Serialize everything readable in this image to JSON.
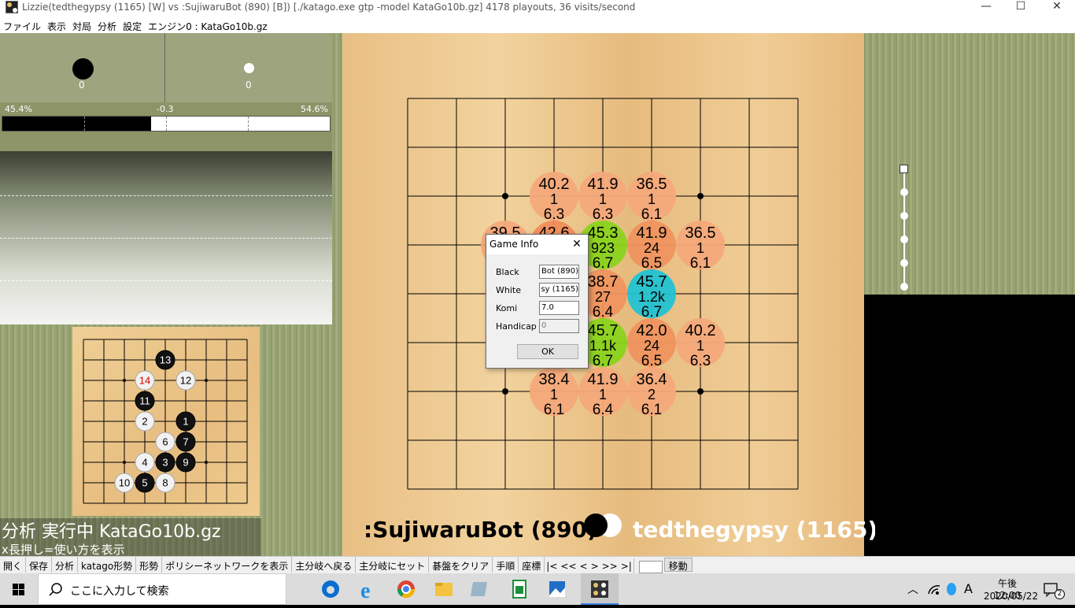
{
  "window": {
    "title": "Lizzie(tedthegypsy (1165) [W] vs :SujiwaruBot (890) [B]) [./katago.exe gtp -model KataGo10b.gz] 4178 playouts, 36 visits/second",
    "minimize": "—",
    "maximize": "☐",
    "close": "✕"
  },
  "menu": [
    "ファイル",
    "表示",
    "対局",
    "分析",
    "設定",
    "エンジン0 : KataGo10b.gz"
  ],
  "score": {
    "black_captures": "0",
    "white_captures": "0",
    "black_winrate": "45.4%",
    "score_lead": "-0.3",
    "white_winrate": "54.6%",
    "black_winrate_value": 45.4
  },
  "status": {
    "line1": "分析 実行中 KataGo10b.gz",
    "line2": "x長押し=使い方を表示"
  },
  "players": {
    "black": ":SujiwaruBot (890)",
    "white": "tedthegypsy (1165)"
  },
  "mini_board_stones": [
    {
      "n": "13",
      "c": "b",
      "col": 4,
      "row": 1
    },
    {
      "n": "14",
      "c": "w",
      "col": 3,
      "row": 2,
      "red": true
    },
    {
      "n": "12",
      "c": "w",
      "col": 5,
      "row": 2
    },
    {
      "n": "11",
      "c": "b",
      "col": 3,
      "row": 3
    },
    {
      "n": "2",
      "c": "w",
      "col": 3,
      "row": 4
    },
    {
      "n": "1",
      "c": "b",
      "col": 5,
      "row": 4
    },
    {
      "n": "6",
      "c": "w",
      "col": 4,
      "row": 5
    },
    {
      "n": "7",
      "c": "b",
      "col": 5,
      "row": 5
    },
    {
      "n": "4",
      "c": "w",
      "col": 3,
      "row": 6
    },
    {
      "n": "3",
      "c": "b",
      "col": 4,
      "row": 6
    },
    {
      "n": "9",
      "c": "b",
      "col": 5,
      "row": 6
    },
    {
      "n": "10",
      "c": "w",
      "col": 2,
      "row": 7
    },
    {
      "n": "5",
      "c": "b",
      "col": 3,
      "row": 7
    },
    {
      "n": "8",
      "c": "w",
      "col": 4,
      "row": 7
    }
  ],
  "candidates": [
    {
      "col": 3,
      "row": 2,
      "wr": "40.2",
      "v": "1",
      "s": "6.3",
      "color": "#f4a97a"
    },
    {
      "col": 4,
      "row": 2,
      "wr": "41.9",
      "v": "1",
      "s": "6.3",
      "color": "#f4a97a"
    },
    {
      "col": 5,
      "row": 2,
      "wr": "36.5",
      "v": "1",
      "s": "6.1",
      "color": "#f4a97a"
    },
    {
      "col": 2,
      "row": 3,
      "wr": "39.5",
      "v": "",
      "s": "",
      "color": "#f4a97a"
    },
    {
      "col": 3,
      "row": 3,
      "wr": "42.6",
      "v": "",
      "s": "",
      "color": "#f08c5a"
    },
    {
      "col": 4,
      "row": 3,
      "wr": "45.3",
      "v": "923",
      "s": "6.7",
      "color": "#8ad31c"
    },
    {
      "col": 5,
      "row": 3,
      "wr": "41.9",
      "v": "24",
      "s": "6.5",
      "color": "#ef935f"
    },
    {
      "col": 6,
      "row": 3,
      "wr": "36.5",
      "v": "1",
      "s": "6.1",
      "color": "#f4a97a"
    },
    {
      "col": 4,
      "row": 4,
      "wr": "38.7",
      "v": "27",
      "s": "6.4",
      "color": "#ef935f"
    },
    {
      "col": 5,
      "row": 4,
      "wr": "45.7",
      "v": "1.2k",
      "s": "6.7",
      "color": "#22c3d3"
    },
    {
      "col": 4,
      "row": 5,
      "wr": "45.7",
      "v": "1.1k",
      "s": "6.7",
      "color": "#8ad31c"
    },
    {
      "col": 5,
      "row": 5,
      "wr": "42.0",
      "v": "24",
      "s": "6.5",
      "color": "#ef935f"
    },
    {
      "col": 6,
      "row": 5,
      "wr": "40.2",
      "v": "1",
      "s": "6.3",
      "color": "#f4a97a"
    },
    {
      "col": 3,
      "row": 6,
      "wr": "38.4",
      "v": "1",
      "s": "6.1",
      "color": "#f4a97a"
    },
    {
      "col": 4,
      "row": 6,
      "wr": "41.9",
      "v": "1",
      "s": "6.4",
      "color": "#f4a97a"
    },
    {
      "col": 5,
      "row": 6,
      "wr": "36.4",
      "v": "2",
      "s": "6.1",
      "color": "#f4a97a"
    }
  ],
  "dialog": {
    "title": "Game Info",
    "black_label": "Black",
    "black_value": "Bot (890)",
    "white_label": "White",
    "white_value": "sy (1165)",
    "komi_label": "Komi",
    "komi_value": "7.0",
    "handicap_label": "Handicap",
    "handicap_value": "0",
    "ok": "OK"
  },
  "toolbar": [
    "開く",
    "保存",
    "分析",
    "katago形勢",
    "形勢",
    "ポリシーネットワークを表示",
    "主分岐へ戻る",
    "主分岐にセット",
    "碁盤をクリア",
    "手順",
    "座標",
    "|<",
    "<<",
    "<",
    ">",
    ">>",
    ">|"
  ],
  "toolbar_move": "移動",
  "taskbar": {
    "search_placeholder": "ここに入力して検索",
    "ime": "A",
    "time_prefix": "午後 12:00",
    "date": "2020/05/22",
    "notifications": "2"
  }
}
